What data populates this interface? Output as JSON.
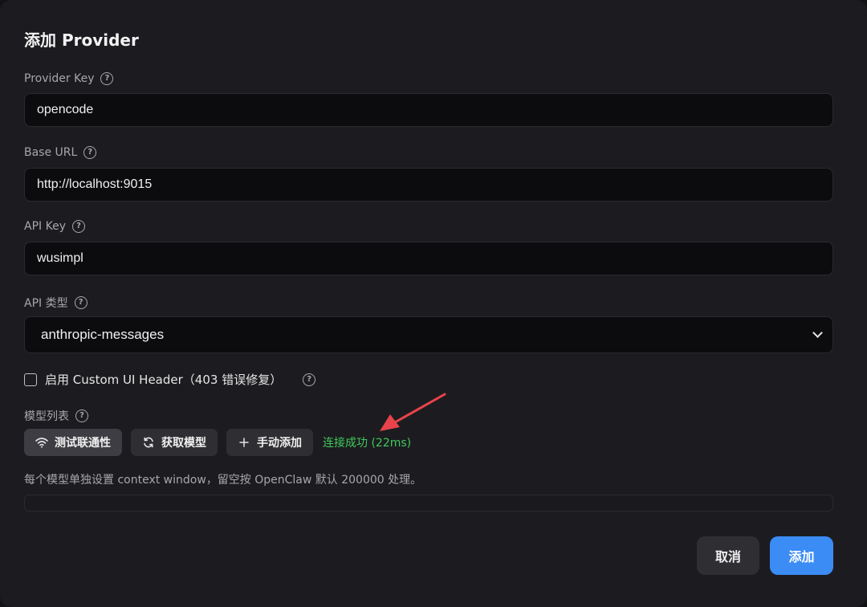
{
  "dialog": {
    "title": "添加 Provider"
  },
  "fields": {
    "provider_key": {
      "label": "Provider Key",
      "value": "opencode"
    },
    "base_url": {
      "label": "Base URL",
      "value": "http://localhost:9015"
    },
    "api_key": {
      "label": "API Key",
      "value": "wusimpl"
    },
    "api_type": {
      "label": "API 类型",
      "value": "anthropic-messages"
    }
  },
  "custom_header": {
    "label": "启用 Custom UI Header（403 错误修复）",
    "checked": false
  },
  "models": {
    "label": "模型列表",
    "buttons": {
      "test": "测试联通性",
      "fetch": "获取模型",
      "manual": "手动添加"
    },
    "status": "连接成功 (22ms)",
    "hint": "每个模型单独设置 context window，留空按 OpenClaw 默认 200000 处理。"
  },
  "footer": {
    "cancel": "取消",
    "add": "添加"
  },
  "help_glyph": "?",
  "colors": {
    "accent": "#3b8cf5",
    "success": "#3fc95a",
    "annotation_arrow": "#e8434a"
  },
  "icons": {
    "help": "question-circle-icon",
    "test": "wifi-icon",
    "fetch": "refresh-icon",
    "manual": "plus-icon",
    "select": "chevron-down-icon"
  }
}
